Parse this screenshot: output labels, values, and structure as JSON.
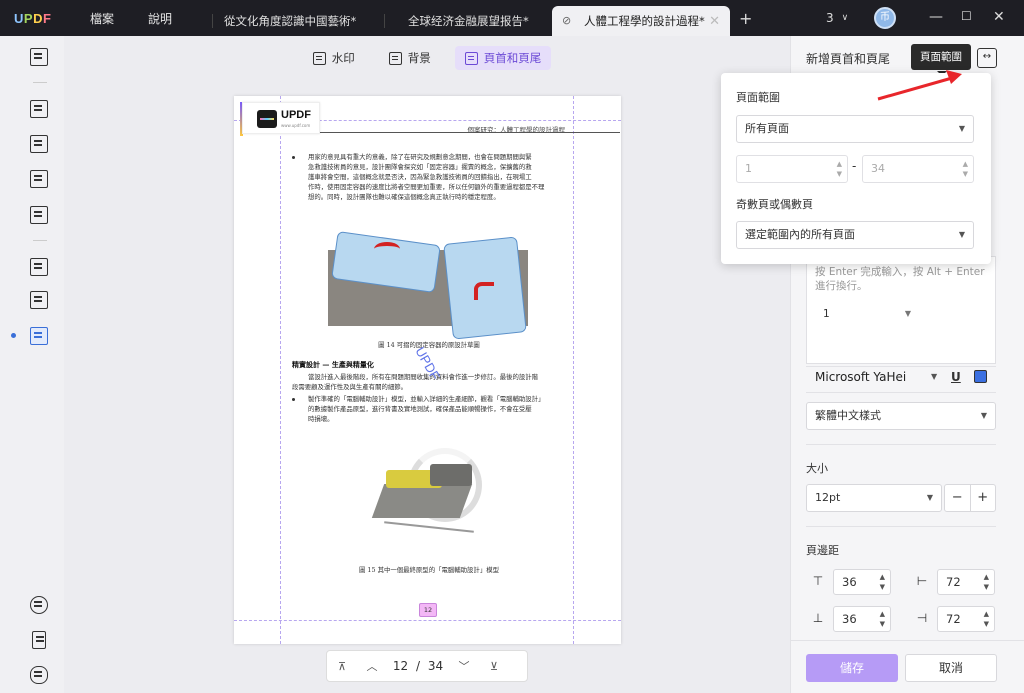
{
  "app": {
    "logo": [
      "U",
      "P",
      "D",
      "F"
    ],
    "menu": [
      "檔案",
      "說明"
    ],
    "tabs": [
      {
        "label": "從文化角度認識中國藝術*",
        "active": false
      },
      {
        "label": "全球经济金融展望报告*",
        "active": false
      },
      {
        "label": "人體工程學的設計過程*",
        "active": true
      }
    ],
    "add_tab": "+",
    "tab_count": "3",
    "avatar_initial": "币",
    "window_buttons": [
      "—",
      "☐",
      "✕"
    ]
  },
  "toolbar": {
    "watermark_label": "水印",
    "background_label": "背景",
    "header_footer_label": "頁首和頁尾"
  },
  "document": {
    "logo_text": "UPDF",
    "logo_sub": "www.updf.com",
    "header_text": "個案研究：人體工程學的設計過程",
    "bullet1": [
      "用家的意見具有重大的意義，除了在研究及規劃意念期間，也會在問題期間與緊",
      "急救護技術員的意見，設計團隊會探究如「固定容器」擺賣的概念，保擴舊的救",
      "護車將會空間，這個概念就是否決，因為緊急救護技術員的回饋指出，在現場工",
      "作時，使用固定容器的速度比將者空間更加重要，所以任何額外的重要過程都是不理",
      "想的。同時，設計團隊也難以確保這個概念真正執行時的穩定程度。"
    ],
    "caption14": "圖 14 可摺的固定容器的原設計草圖",
    "section_title": "精實設計 — 生產與精量化",
    "section_line1": "當設計進入最後階段，所有在問題期間收集的資料會作進一步修訂。最後的設計階",
    "section_line2": "段需要顧及運作性及與生產有關的細節。",
    "bullet2": [
      "製作準確的「電腦輔助設計」模型，並輸入詳細的生產細節，觀看「電腦輔助設計」",
      "的數據製作產品原型，進行背書及實地測試，確保產品能順暢操作，不會在受壓",
      "時損壞。"
    ],
    "caption15": "圖 15 其中一個最終原型的「電腦輔助設計」模型",
    "watermark": "UPDF",
    "page_badge": "12"
  },
  "pager": {
    "current": "12",
    "separator": "/",
    "total": "34"
  },
  "panel": {
    "title": "新增頁首和頁尾",
    "tooltip": "頁面範圍",
    "text_placeholder": "按 Enter 完成輸入，按 Alt + Enter 進行換行。",
    "page_number_format": "1",
    "font_name": "Microsoft YaHei",
    "underline_glyph": "U",
    "accent_color": "#3b6fe0",
    "style_select": "繁體中文樣式",
    "size_label": "大小",
    "size_value": "12pt",
    "minus": "−",
    "plus": "+",
    "margin_label": "頁邊距",
    "margin_top": "36",
    "margin_left": "72",
    "margin_bottom": "36",
    "margin_right": "72",
    "save": "儲存",
    "cancel": "取消"
  },
  "popup": {
    "range_label": "頁面範圍",
    "range_value": "所有頁面",
    "from": "1",
    "dash": "-",
    "to": "34",
    "odd_even_label": "奇數頁或偶數頁",
    "odd_even_value": "選定範圍內的所有頁面"
  }
}
